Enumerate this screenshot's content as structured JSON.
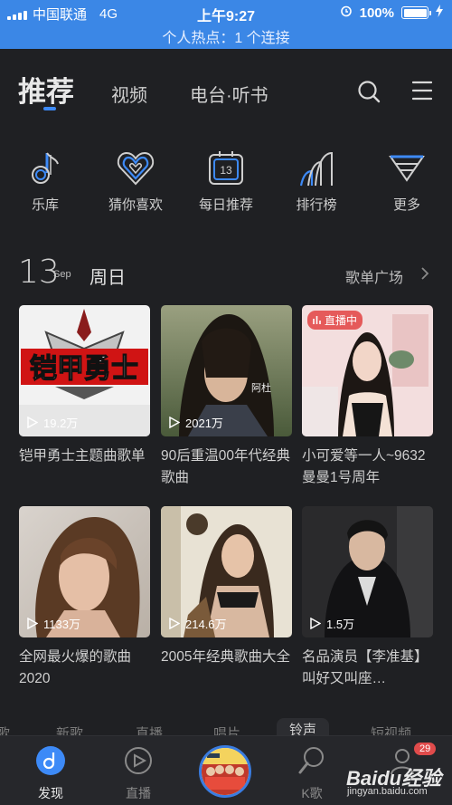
{
  "status_bar": {
    "carrier": "中国联通",
    "network": "4G",
    "time": "上午9:27",
    "battery": "100%",
    "hotspot": "个人热点：1 个连接"
  },
  "top_nav": {
    "tabs": [
      "推荐",
      "视频",
      "电台·听书"
    ],
    "active_tab": "推荐",
    "icons": [
      "search-icon",
      "menu-icon"
    ]
  },
  "quick_entries": [
    {
      "label": "乐库",
      "icon": "music-note-icon"
    },
    {
      "label": "猜你喜欢",
      "icon": "heart-icon"
    },
    {
      "label": "每日推荐",
      "icon": "calendar-icon",
      "icon_text": "13"
    },
    {
      "label": "排行榜",
      "icon": "chart-icon"
    },
    {
      "label": "更多",
      "icon": "more-icon"
    }
  ],
  "section": {
    "day": "13",
    "month": "Sep",
    "weekday": "周日",
    "link": "歌单广场"
  },
  "cards": [
    {
      "title": "铠甲勇士主题曲歌单",
      "plays": "19.2万",
      "cover_text": "铠甲勇士"
    },
    {
      "title": "90后重温00年代经典歌曲",
      "plays": "2021万",
      "cover_text": "阿杜"
    },
    {
      "title": "小可爱等一人~9632曼曼1号周年",
      "plays": "",
      "badge": "直播中"
    },
    {
      "title": "全网最火爆的歌曲2020",
      "plays": "1133万"
    },
    {
      "title": "2005年经典歌曲大全",
      "plays": "214.6万"
    },
    {
      "title": "名品演员【李准基】叫好又叫座…",
      "plays": "1.5万"
    }
  ],
  "categories": [
    "歌",
    "新歌",
    "直播",
    "唱片",
    "铃声",
    "短视频"
  ],
  "active_category": "铃声",
  "tab_bar": [
    {
      "label": "发现",
      "icon": "discover-icon"
    },
    {
      "label": "直播",
      "icon": "live-play-icon"
    },
    {
      "label": "",
      "icon": "now-playing-disc"
    },
    {
      "label": "K歌",
      "icon": "k-song-icon"
    },
    {
      "label": "",
      "icon": "message-icon"
    }
  ],
  "message_count": "29",
  "watermark": {
    "brand": "Baidu经验",
    "url": "jingyan.baidu.com"
  },
  "colors": {
    "accent": "#3d8af7",
    "background": "#1f2023",
    "status_bar": "#3b87e6",
    "live_badge": "#e55a5a"
  }
}
